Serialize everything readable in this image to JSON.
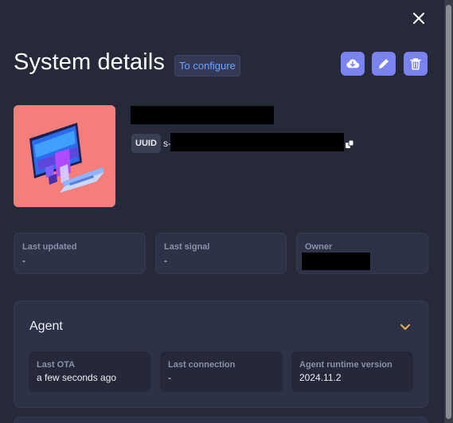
{
  "header": {
    "title": "System details",
    "status_badge": "To configure"
  },
  "actions": {
    "close_icon": "close-icon",
    "download_icon": "download-cloud-icon",
    "edit_icon": "pencil-icon",
    "delete_icon": "trash-icon",
    "accent_color": "#7b82f3"
  },
  "system": {
    "uuid_label": "UUID",
    "uuid_prefix": "s-",
    "thumbnail_background": "#f57e7a"
  },
  "info_cards": [
    {
      "label": "Last updated",
      "value": "-"
    },
    {
      "label": "Last signal",
      "value": "-"
    },
    {
      "label": "Owner",
      "value": ""
    }
  ],
  "agent": {
    "title": "Agent",
    "items": [
      {
        "label": "Last OTA",
        "value": "a few seconds ago"
      },
      {
        "label": "Last connection",
        "value": "-"
      },
      {
        "label": "Agent runtime version",
        "value": "2024.11.2"
      }
    ]
  }
}
